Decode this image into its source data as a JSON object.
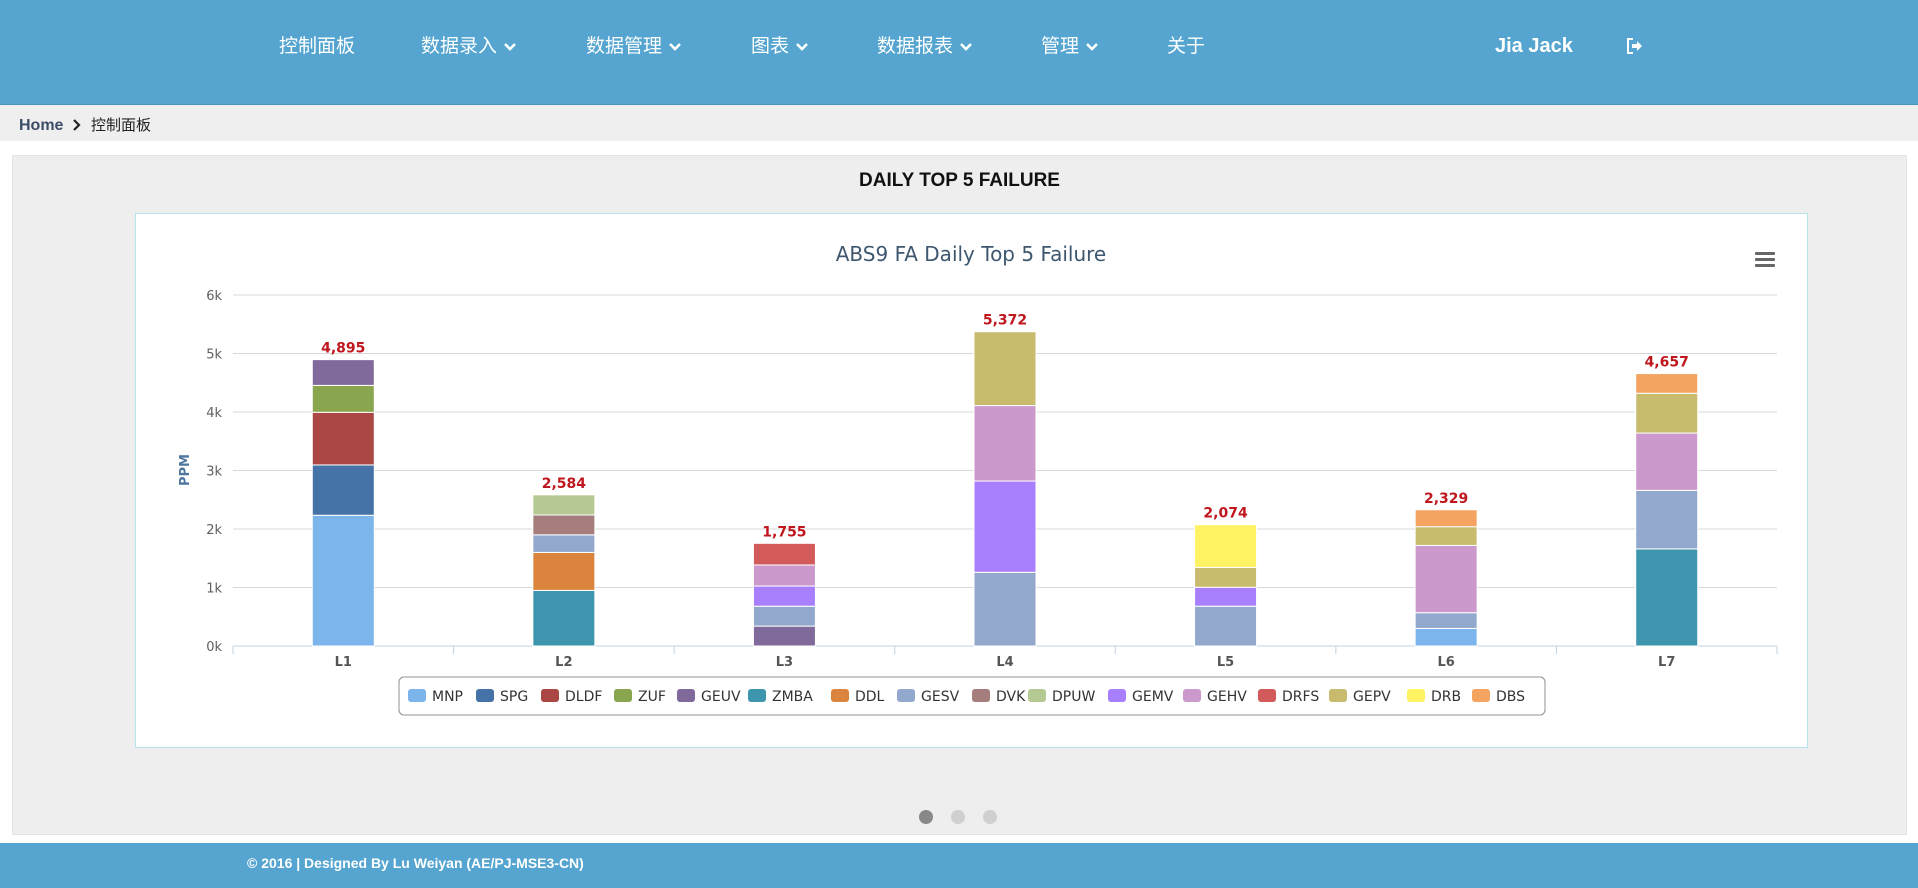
{
  "nav": {
    "items": [
      {
        "label": "控制面板",
        "dropdown": false
      },
      {
        "label": "数据录入",
        "dropdown": true
      },
      {
        "label": "数据管理",
        "dropdown": true
      },
      {
        "label": "图表",
        "dropdown": true
      },
      {
        "label": "数据报表",
        "dropdown": true
      },
      {
        "label": "管理",
        "dropdown": true
      },
      {
        "label": "关于",
        "dropdown": false
      }
    ],
    "user": "Jia Jack",
    "logout_icon": "sign-out-icon"
  },
  "breadcrumb": {
    "home": "Home",
    "current": "控制面板"
  },
  "panel": {
    "title": "DAILY TOP 5 FAILURE"
  },
  "carousel": {
    "count": 3,
    "active": 0
  },
  "footer": {
    "text": "© 2016 | Designed By Lu Weiyan (AE/PJ-MSE3-CN)"
  },
  "colors": {
    "nav_bg": "#55a5d0",
    "total_label": "#c0161d",
    "title": "#3e576f"
  },
  "chart_data": {
    "type": "bar",
    "stacked": true,
    "title": "ABS9 FA Daily Top 5 Failure",
    "xlabel": "",
    "ylabel": "PPM",
    "ylim": [
      0,
      6000
    ],
    "yticks": [
      0,
      1000,
      2000,
      3000,
      4000,
      5000,
      6000
    ],
    "ytick_labels": [
      "0k",
      "1k",
      "2k",
      "3k",
      "4k",
      "5k",
      "6k"
    ],
    "categories": [
      "L1",
      "L2",
      "L3",
      "L4",
      "L5",
      "L6",
      "L7"
    ],
    "totals": [
      4895,
      2584,
      1755,
      5372,
      2074,
      2329,
      4657
    ],
    "total_labels": [
      "4,895",
      "2,584",
      "1,755",
      "5,372",
      "2,074",
      "2,329",
      "4,657"
    ],
    "legend_position": "bottom-center",
    "grid": true,
    "menu_icon": "hamburger-menu-icon",
    "series": [
      {
        "name": "MNP",
        "color": "#7cb5ec",
        "values": [
          2235,
          0,
          0,
          0,
          0,
          300,
          0
        ]
      },
      {
        "name": "SPG",
        "color": "#4572a7",
        "values": [
          860,
          0,
          0,
          0,
          0,
          0,
          0
        ]
      },
      {
        "name": "DLDF",
        "color": "#aa4643",
        "values": [
          900,
          0,
          0,
          0,
          0,
          0,
          0
        ]
      },
      {
        "name": "ZUF",
        "color": "#89a54e",
        "values": [
          460,
          0,
          0,
          0,
          0,
          0,
          0
        ]
      },
      {
        "name": "GEUV",
        "color": "#80699b",
        "values": [
          440,
          0,
          340,
          0,
          0,
          0,
          0
        ]
      },
      {
        "name": "ZMBA",
        "color": "#3d96ae",
        "values": [
          0,
          950,
          0,
          0,
          0,
          0,
          1660
        ]
      },
      {
        "name": "DDL",
        "color": "#db843d",
        "values": [
          0,
          650,
          0,
          0,
          0,
          0,
          0
        ]
      },
      {
        "name": "GESV",
        "color": "#92a8cd",
        "values": [
          0,
          300,
          340,
          1260,
          680,
          269,
          1000
        ]
      },
      {
        "name": "DVK",
        "color": "#a47d7c",
        "values": [
          0,
          340,
          0,
          0,
          0,
          0,
          0
        ]
      },
      {
        "name": "DPUW",
        "color": "#b5ca92",
        "values": [
          0,
          344,
          0,
          0,
          0,
          0,
          0
        ]
      },
      {
        "name": "GEMV",
        "color": "#a880ff",
        "values": [
          0,
          0,
          345,
          1560,
          324,
          0,
          0
        ]
      },
      {
        "name": "GEHV",
        "color": "#cc99cc",
        "values": [
          0,
          0,
          360,
          1290,
          0,
          1150,
          980
        ]
      },
      {
        "name": "DRFS",
        "color": "#d35a5a",
        "values": [
          0,
          0,
          370,
          0,
          0,
          0,
          0
        ]
      },
      {
        "name": "GEPV",
        "color": "#c9bb6d",
        "values": [
          0,
          0,
          0,
          1262,
          340,
          320,
          680
        ]
      },
      {
        "name": "DRB",
        "color": "#fff263",
        "values": [
          0,
          0,
          0,
          0,
          730,
          0,
          0
        ]
      },
      {
        "name": "DBS",
        "color": "#f4a460",
        "values": [
          0,
          0,
          0,
          0,
          0,
          290,
          337
        ]
      }
    ]
  }
}
